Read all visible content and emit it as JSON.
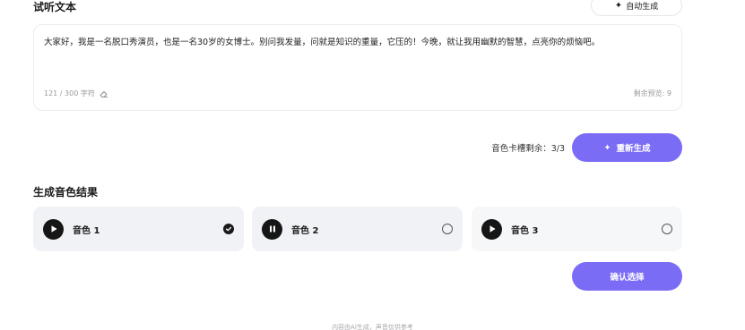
{
  "preview": {
    "title": "试听文本",
    "auto_generate_label": "自动生成",
    "text": "大家好，我是一名脱口秀演员，也是一名30岁的女博士。别问我发量，问就是知识的重量，它压的！今晚，就让我用幽默的智慧，点亮你的烦恼吧。",
    "char_count": "121 / 300 字符",
    "remaining_preview": "剩余预览: 9"
  },
  "regen": {
    "slots_remaining": "音色卡槽剩余：3/3",
    "button_label": "重新生成"
  },
  "results": {
    "title": "生成音色结果",
    "voices": [
      {
        "name": "音色 1",
        "state": "play",
        "selected": true
      },
      {
        "name": "音色 2",
        "state": "pause",
        "selected": false
      },
      {
        "name": "音色 3",
        "state": "play",
        "selected": false
      }
    ]
  },
  "confirm_label": "确认选择",
  "disclaimer": "内容由AI生成，声音仅供参考"
}
